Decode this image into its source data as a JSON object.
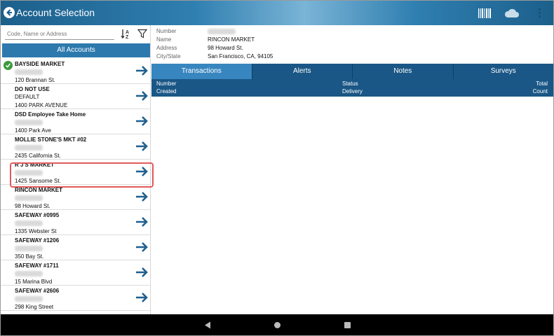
{
  "header": {
    "title": "Account Selection",
    "icons": [
      "back-arrow-icon",
      "barcode-icon",
      "cloud-icon",
      "overflow-menu-icon"
    ]
  },
  "sidebar": {
    "search_placeholder": "Code, Name or Address",
    "all_accounts_label": "All Accounts",
    "accounts": [
      {
        "name": "BAYSIDE MARKET",
        "line2": "",
        "address": "120 Brannan St.",
        "verified": true
      },
      {
        "name": "DO NOT USE",
        "line2": "DEFAULT",
        "address": "1400 PARK AVENUE",
        "verified": false
      },
      {
        "name": "DSD Employee Take Home",
        "line2": "",
        "address": "1400 Park Ave",
        "verified": false
      },
      {
        "name": "MOLLIE STONE'S MKT #02",
        "line2": "",
        "address": "2435 California St.",
        "verified": false
      },
      {
        "name": "R J'S MARKET",
        "line2": "",
        "address": "1425 Sansome St.",
        "verified": false
      },
      {
        "name": "RINCON MARKET",
        "line2": "",
        "address": "98 Howard St.",
        "verified": false
      },
      {
        "name": "SAFEWAY #0995",
        "line2": "",
        "address": "1335 Webster St",
        "verified": false
      },
      {
        "name": "SAFEWAY #1206",
        "line2": "",
        "address": "350 Bay St.",
        "verified": false
      },
      {
        "name": "SAFEWAY #1711",
        "line2": "",
        "address": "15  Marina Blvd",
        "verified": false
      },
      {
        "name": "SAFEWAY #2606",
        "line2": "",
        "address": "298 King Street",
        "verified": false
      }
    ]
  },
  "details": {
    "number_label": "Number",
    "name_label": "Name",
    "name_value": "RINCON MARKET",
    "address_label": "Address",
    "address_value": "98 Howard St.",
    "city_label": "City/State",
    "city_value": "San Francisco, CA, 94105"
  },
  "tabs": [
    "Transactions",
    "Alerts",
    "Notes",
    "Surveys"
  ],
  "columns": {
    "number": "Number",
    "created": "Created",
    "status": "Status",
    "delivery": "Delivery",
    "total": "Total",
    "count": "Count"
  },
  "colors": {
    "accent": "#2d79ad",
    "tab_bar": "#1a5786",
    "active_tab": "#3886bf",
    "highlight": "#e05a5a"
  }
}
